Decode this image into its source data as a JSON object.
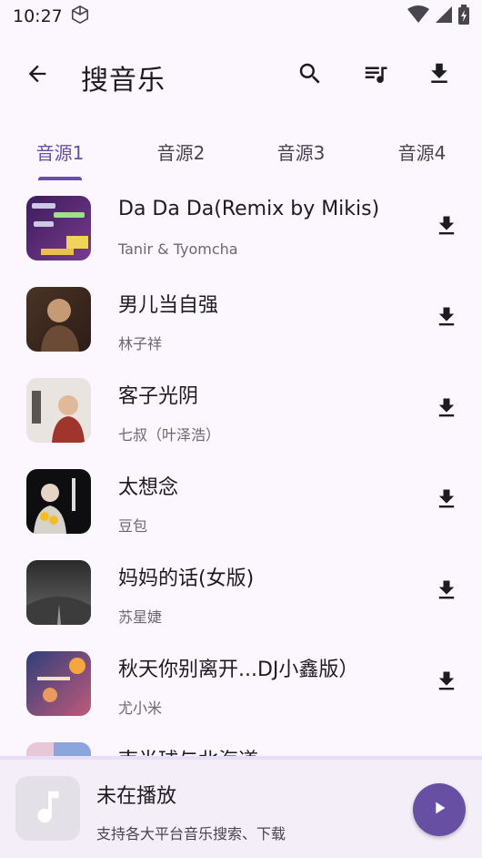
{
  "status": {
    "time": "10:27"
  },
  "header": {
    "title": "搜音乐"
  },
  "tabs": [
    {
      "label": "音源1",
      "active": true
    },
    {
      "label": "音源2",
      "active": false
    },
    {
      "label": "音源3",
      "active": false
    },
    {
      "label": "音源4",
      "active": false
    }
  ],
  "songs": [
    {
      "title": "Da Da Da(Remix by Mikis)",
      "artist": "Tanir & Tyomcha"
    },
    {
      "title": "男儿当自强",
      "artist": "林子祥"
    },
    {
      "title": "客子光阴",
      "artist": "七叔（叶泽浩）"
    },
    {
      "title": "太想念",
      "artist": "豆包"
    },
    {
      "title": "妈妈的话(女版)",
      "artist": "苏星婕"
    },
    {
      "title": "秋天你别离开...DJ小鑫版）",
      "artist": "尤小米"
    },
    {
      "title": "南半球与北海道",
      "artist": ""
    }
  ],
  "player": {
    "title": "未在播放",
    "subtitle": "支持各大平台音乐搜索、下载"
  },
  "colors": {
    "accent": "#6750a4",
    "background": "#fcf6fe"
  }
}
